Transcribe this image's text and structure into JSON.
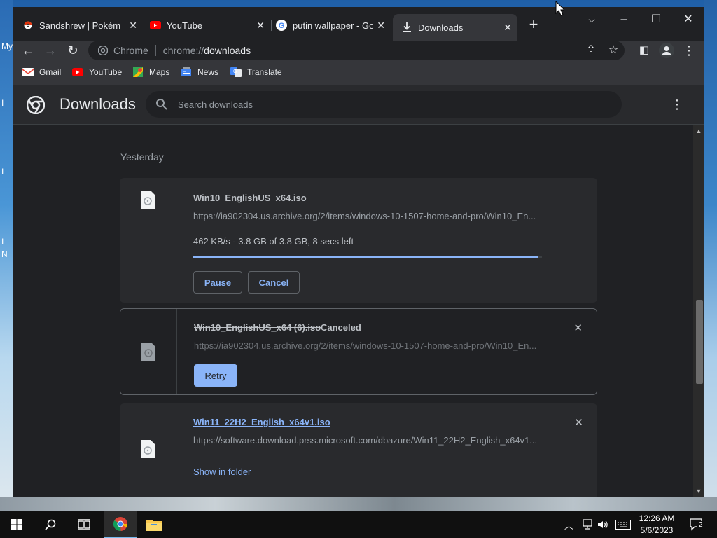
{
  "desktop": {
    "labels": [
      "My",
      "I",
      "I",
      "I",
      "N"
    ]
  },
  "tabs": [
    {
      "title": "Sandshrew | Pokémon",
      "icon": "pokeball-icon",
      "close": "✕"
    },
    {
      "title": "YouTube",
      "icon": "youtube-icon",
      "close": "✕"
    },
    {
      "title": "putin wallpaper - Goo",
      "icon": "google-icon",
      "close": "✕"
    },
    {
      "title": "Downloads",
      "icon": "download-icon",
      "close": "✕",
      "active": true
    }
  ],
  "omnibox": {
    "site_label": "Chrome",
    "url_scheme": "chrome://",
    "url_host": "downloads"
  },
  "bookmarks": [
    {
      "label": "Gmail",
      "icon": "gmail-icon"
    },
    {
      "label": "YouTube",
      "icon": "youtube-icon"
    },
    {
      "label": "Maps",
      "icon": "maps-icon"
    },
    {
      "label": "News",
      "icon": "news-icon"
    },
    {
      "label": "Translate",
      "icon": "translate-icon"
    }
  ],
  "downloads_page": {
    "title": "Downloads",
    "search_placeholder": "Search downloads",
    "section_date": "Yesterday",
    "items": [
      {
        "name": "Win10_EnglishUS_x64.iso",
        "url": "https://ia902304.us.archive.org/2/items/windows-10-1507-home-and-pro/Win10_En...",
        "status": "462 KB/s - 3.8 GB of 3.8 GB, 8 secs left",
        "progress": 0.99,
        "pause_label": "Pause",
        "cancel_label": "Cancel"
      },
      {
        "name": "Win10_EnglishUS_x64 (6).iso",
        "state": "Canceled",
        "url": "https://ia902304.us.archive.org/2/items/windows-10-1507-home-and-pro/Win10_En...",
        "retry_label": "Retry"
      },
      {
        "name": "Win11_22H2_English_x64v1.iso",
        "url": "https://software.download.prss.microsoft.com/dbazure/Win11_22H2_English_x64v1...",
        "show_in_folder_label": "Show in folder"
      }
    ]
  },
  "taskbar": {
    "time": "12:26 AM",
    "date": "5/6/2023",
    "notification_count": "2"
  },
  "colors": {
    "accent": "#8ab4f8",
    "bg": "#202124",
    "surface": "#292a2d"
  }
}
